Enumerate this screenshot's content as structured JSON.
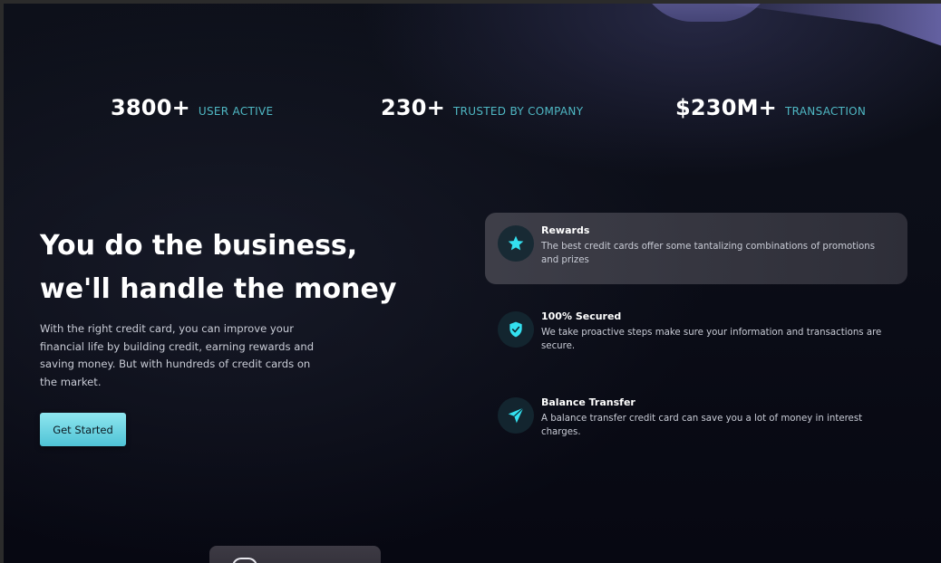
{
  "stats": [
    {
      "number": "3800+",
      "label": "USER ACTIVE"
    },
    {
      "number": "230+",
      "label": "TRUSTED BY COMPANY"
    },
    {
      "number": "$230M+",
      "label": "TRANSACTION"
    }
  ],
  "hero": {
    "title_line1": "You do the business,",
    "title_line2": "we'll handle the money",
    "description": "With the right credit card, you can improve your financial life by building credit, earning rewards and saving money. But with hundreds of credit cards on the market.",
    "cta_label": "Get Started"
  },
  "features": [
    {
      "icon": "star-icon",
      "title": "Rewards",
      "text": "The best credit cards offer some tantalizing combinations of promotions and prizes",
      "active": true
    },
    {
      "icon": "shield-check-icon",
      "title": "100% Secured",
      "text": "We take proactive steps make sure your information and transactions are secure.",
      "active": false
    },
    {
      "icon": "send-icon",
      "title": "Balance Transfer",
      "text": "A balance transfer credit card can save you a lot of money in interest charges.",
      "active": false
    }
  ],
  "colors": {
    "accent": "#4fb8c4",
    "button": "#5cc9da",
    "background": "#0b0d17",
    "icon": "#33e0f0"
  }
}
